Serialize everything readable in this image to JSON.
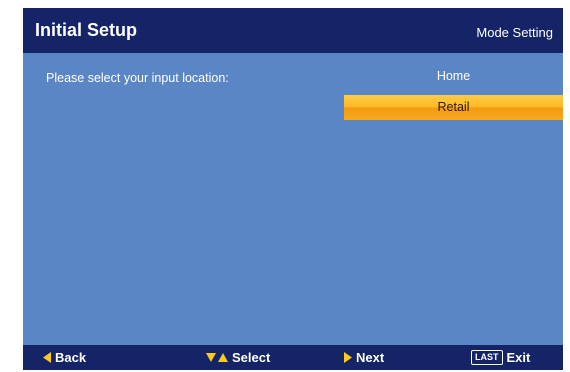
{
  "header": {
    "title": "Initial Setup",
    "subtitle": "Mode Setting"
  },
  "main": {
    "prompt": "Please select your input location:",
    "options": [
      {
        "label": "Home",
        "selected": false
      },
      {
        "label": "Retail",
        "selected": true
      }
    ]
  },
  "footer": {
    "back": {
      "label": "Back",
      "icon": "arrow-left-icon"
    },
    "select": {
      "label": "Select",
      "icon": "arrows-up-down-icon"
    },
    "next": {
      "label": "Next",
      "icon": "arrow-right-icon"
    },
    "exit": {
      "label": "Exit",
      "key_label": "LAST"
    }
  },
  "colors": {
    "background": "#5b86c5",
    "bar": "#142467",
    "highlight": "#ffb726",
    "icon_yellow": "#ffc81e"
  }
}
